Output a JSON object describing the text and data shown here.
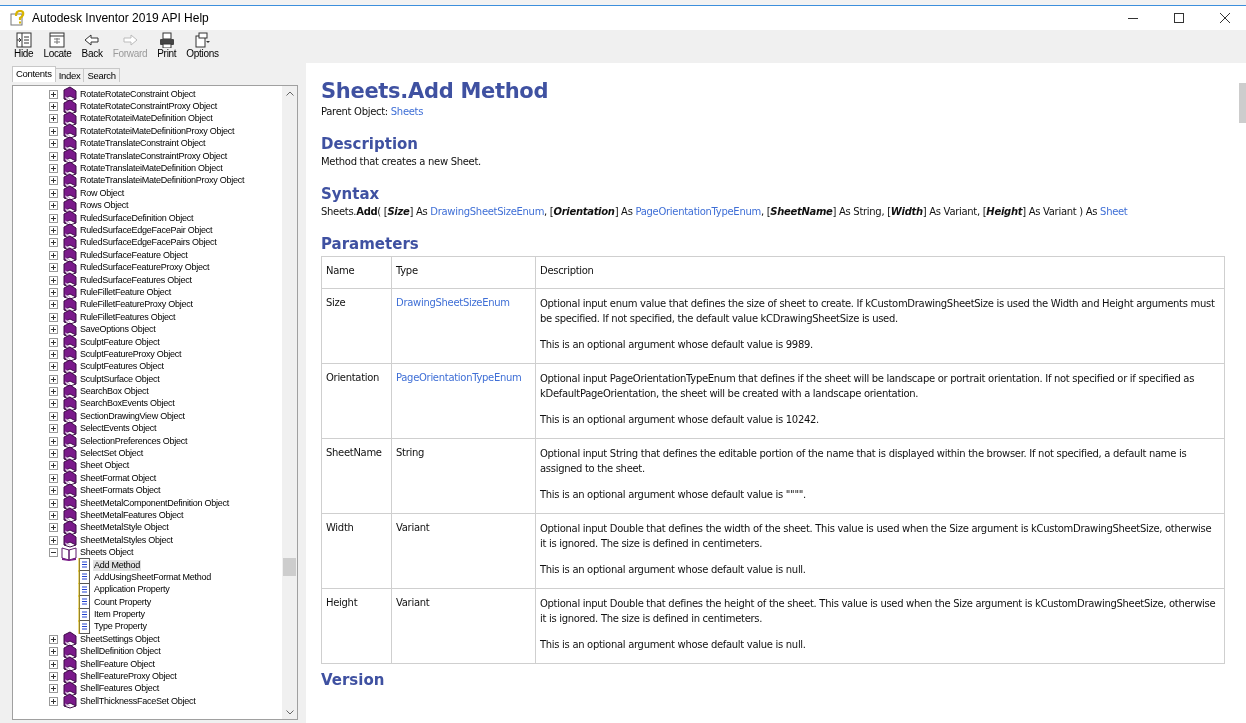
{
  "window": {
    "title": "Autodesk Inventor 2019 API Help"
  },
  "toolbar": [
    {
      "kind": "hide",
      "label": "Hide",
      "disabled": false
    },
    {
      "kind": "locate",
      "label": "Locate",
      "disabled": false
    },
    {
      "kind": "back",
      "label": "Back",
      "disabled": false
    },
    {
      "kind": "forward",
      "label": "Forward",
      "disabled": true
    },
    {
      "kind": "print",
      "label": "Print",
      "disabled": false
    },
    {
      "kind": "options",
      "label": "Options",
      "disabled": false
    }
  ],
  "tabs": [
    {
      "label": "Contents",
      "selected": true
    },
    {
      "label": "Index",
      "selected": false
    },
    {
      "label": "Search",
      "selected": false
    }
  ],
  "tree": [
    {
      "label": "RotateRotateConstraint Object",
      "expanded": false,
      "selected": false
    },
    {
      "label": "RotateRotateConstraintProxy Object",
      "expanded": false,
      "selected": false
    },
    {
      "label": "RotateRotateiMateDefinition Object",
      "expanded": false,
      "selected": false
    },
    {
      "label": "RotateRotateiMateDefinitionProxy Object",
      "expanded": false,
      "selected": false
    },
    {
      "label": "RotateTranslateConstraint Object",
      "expanded": false,
      "selected": false
    },
    {
      "label": "RotateTranslateConstraintProxy Object",
      "expanded": false,
      "selected": false
    },
    {
      "label": "RotateTranslateiMateDefinition Object",
      "expanded": false,
      "selected": false
    },
    {
      "label": "RotateTranslateiMateDefinitionProxy Object",
      "expanded": false,
      "selected": false
    },
    {
      "label": "Row Object",
      "expanded": false,
      "selected": false
    },
    {
      "label": "Rows Object",
      "expanded": false,
      "selected": false
    },
    {
      "label": "RuledSurfaceDefinition Object",
      "expanded": false,
      "selected": false
    },
    {
      "label": "RuledSurfaceEdgeFacePair Object",
      "expanded": false,
      "selected": false
    },
    {
      "label": "RuledSurfaceEdgeFacePairs Object",
      "expanded": false,
      "selected": false
    },
    {
      "label": "RuledSurfaceFeature Object",
      "expanded": false,
      "selected": false
    },
    {
      "label": "RuledSurfaceFeatureProxy Object",
      "expanded": false,
      "selected": false
    },
    {
      "label": "RuledSurfaceFeatures Object",
      "expanded": false,
      "selected": false
    },
    {
      "label": "RuleFilletFeature Object",
      "expanded": false,
      "selected": false
    },
    {
      "label": "RuleFilletFeatureProxy Object",
      "expanded": false,
      "selected": false
    },
    {
      "label": "RuleFilletFeatures Object",
      "expanded": false,
      "selected": false
    },
    {
      "label": "SaveOptions Object",
      "expanded": false,
      "selected": false
    },
    {
      "label": "SculptFeature Object",
      "expanded": false,
      "selected": false
    },
    {
      "label": "SculptFeatureProxy Object",
      "expanded": false,
      "selected": false
    },
    {
      "label": "SculptFeatures Object",
      "expanded": false,
      "selected": false
    },
    {
      "label": "SculptSurface Object",
      "expanded": false,
      "selected": false
    },
    {
      "label": "SearchBox Object",
      "expanded": false,
      "selected": false
    },
    {
      "label": "SearchBoxEvents Object",
      "expanded": false,
      "selected": false
    },
    {
      "label": "SectionDrawingView Object",
      "expanded": false,
      "selected": false
    },
    {
      "label": "SelectEvents Object",
      "expanded": false,
      "selected": false
    },
    {
      "label": "SelectionPreferences Object",
      "expanded": false,
      "selected": false
    },
    {
      "label": "SelectSet Object",
      "expanded": false,
      "selected": false
    },
    {
      "label": "Sheet Object",
      "expanded": false,
      "selected": false
    },
    {
      "label": "SheetFormat Object",
      "expanded": false,
      "selected": false
    },
    {
      "label": "SheetFormats Object",
      "expanded": false,
      "selected": false
    },
    {
      "label": "SheetMetalComponentDefinition Object",
      "expanded": false,
      "selected": false
    },
    {
      "label": "SheetMetalFeatures Object",
      "expanded": false,
      "selected": false
    },
    {
      "label": "SheetMetalStyle Object",
      "expanded": false,
      "selected": false
    },
    {
      "label": "SheetMetalStyles Object",
      "expanded": false,
      "selected": false
    },
    {
      "label": "Sheets Object",
      "expanded": true,
      "selected": false,
      "children": [
        {
          "label": "Add Method",
          "selected": true
        },
        {
          "label": "AddUsingSheetFormat Method",
          "selected": false
        },
        {
          "label": "Application Property",
          "selected": false
        },
        {
          "label": "Count Property",
          "selected": false
        },
        {
          "label": "Item Property",
          "selected": false
        },
        {
          "label": "Type Property",
          "selected": false
        }
      ]
    },
    {
      "label": "SheetSettings Object",
      "expanded": false,
      "selected": false
    },
    {
      "label": "ShellDefinition Object",
      "expanded": false,
      "selected": false
    },
    {
      "label": "ShellFeature Object",
      "expanded": false,
      "selected": false
    },
    {
      "label": "ShellFeatureProxy Object",
      "expanded": false,
      "selected": false
    },
    {
      "label": "ShellFeatures Object",
      "expanded": false,
      "selected": false
    },
    {
      "label": "ShellThicknessFaceSet Object",
      "expanded": false,
      "selected": false
    }
  ],
  "content": {
    "title": "Sheets.Add Method",
    "parent": [
      {
        "kind": "text",
        "text": "Parent Object: "
      },
      {
        "kind": "link",
        "text": "Sheets"
      }
    ],
    "description_heading": "Description",
    "description": "Method that creates a new Sheet.",
    "syntax_heading": "Syntax",
    "syntax": [
      {
        "kind": "text",
        "text": "Sheets."
      },
      {
        "kind": "bold",
        "text": "Add"
      },
      {
        "kind": "text",
        "text": "( ["
      },
      {
        "kind": "param",
        "text": "Size"
      },
      {
        "kind": "text",
        "text": "] As "
      },
      {
        "kind": "link",
        "text": "DrawingSheetSizeEnum"
      },
      {
        "kind": "text",
        "text": ", ["
      },
      {
        "kind": "param",
        "text": "Orientation"
      },
      {
        "kind": "text",
        "text": "] As "
      },
      {
        "kind": "link",
        "text": "PageOrientationTypeEnum"
      },
      {
        "kind": "text",
        "text": ", ["
      },
      {
        "kind": "param",
        "text": "SheetName"
      },
      {
        "kind": "text",
        "text": "] As String, ["
      },
      {
        "kind": "param",
        "text": "Width"
      },
      {
        "kind": "text",
        "text": "] As Variant, ["
      },
      {
        "kind": "param",
        "text": "Height"
      },
      {
        "kind": "text",
        "text": "] As Variant ) As "
      },
      {
        "kind": "link",
        "text": "Sheet"
      }
    ],
    "parameters_heading": "Parameters",
    "columns": [
      "Name",
      "Type",
      "Description"
    ],
    "parameters": [
      {
        "name": "Size",
        "type": "DrawingSheetSizeEnum",
        "type_is_link": true,
        "description": [
          "Optional input enum value that defines the size of sheet to create. If kCustomDrawingSheetSize is used the Width and Height arguments must be specified. If not specified, the default value kCDrawingSheetSize is used.",
          "This is an optional argument whose default value is 9989."
        ]
      },
      {
        "name": "Orientation",
        "type": "PageOrientationTypeEnum",
        "type_is_link": true,
        "description": [
          "Optional input PageOrientationTypeEnum that defines if the sheet will be landscape or portrait orientation. If not specified or if specified as kDefaultPageOrientation, the sheet will be created with a landscape orientation.",
          "This is an optional argument whose default value is 10242."
        ]
      },
      {
        "name": "SheetName",
        "type": "String",
        "type_is_link": false,
        "description": [
          "Optional input String that defines the editable portion of the name that is displayed within the browser. If not specified, a default name is assigned to the sheet.",
          "This is an optional argument whose default value is \"\"\"\"."
        ]
      },
      {
        "name": "Width",
        "type": "Variant",
        "type_is_link": false,
        "description": [
          "Optional input Double that defines the width of the sheet. This value is used when the Size argument is kCustomDrawingSheetSize, otherwise it is ignored. The size is defined in centimeters.",
          "This is an optional argument whose default value is null."
        ]
      },
      {
        "name": "Height",
        "type": "Variant",
        "type_is_link": false,
        "description": [
          "Optional input Double that defines the height of the sheet. This value is used when the Size argument is kCustomDrawingSheetSize, otherwise it is ignored. The size is defined in centimeters.",
          "This is an optional argument whose default value is null."
        ]
      }
    ],
    "version_heading": "Version"
  }
}
